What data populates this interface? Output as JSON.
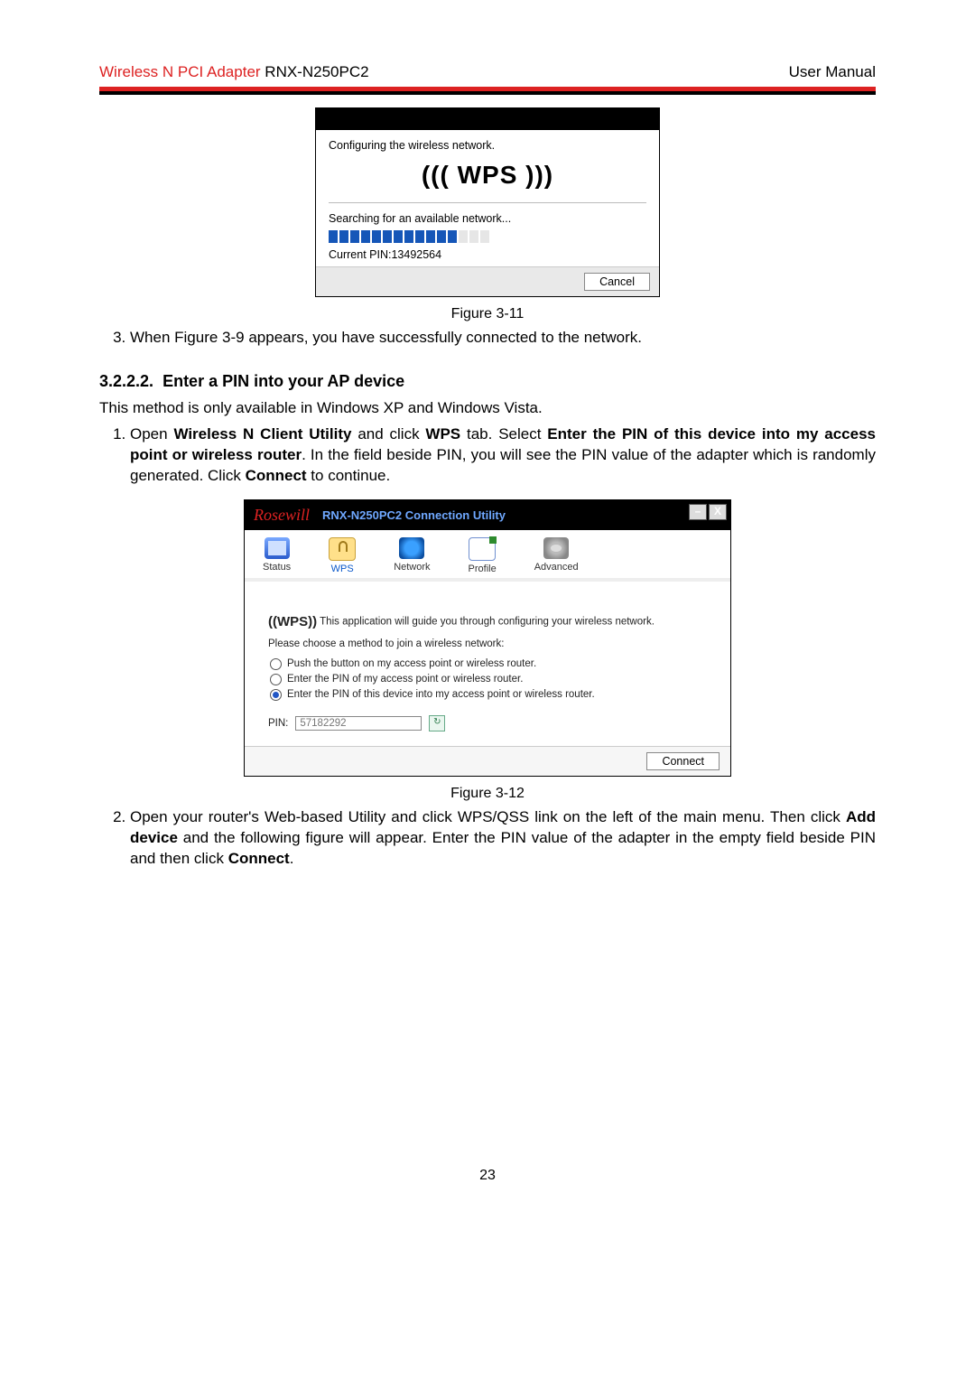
{
  "header": {
    "left_red": "Wireless N PCI Adapter",
    "left_black": " RNX-N250PC2",
    "right": "User Manual"
  },
  "dialog1": {
    "line1": "Configuring the wireless network.",
    "wps_label": "((( WPS )))",
    "line2": "Searching for an available network...",
    "pin_line": "Current PIN:13492564",
    "cancel": "Cancel"
  },
  "fig1_caption": "Figure 3-11",
  "step3": "When Figure 3-9 appears, you have successfully connected to the network.",
  "section_num": "3.2.2.2.",
  "section_title": "Enter a PIN into your AP device",
  "para_a": "This method is only available in Windows XP and Windows Vista.",
  "step1_pre": "Open ",
  "step1_b1": "Wireless N Client Utility",
  "step1_mid1": " and click ",
  "step1_b2": "WPS",
  "step1_mid2": " tab. Select ",
  "step1_b3": "Enter the PIN of this device into my access point or wireless router",
  "step1_mid3": ". In the field beside PIN, you will see the PIN value of the adapter which is randomly generated. Click ",
  "step1_b4": "Connect",
  "step1_end": " to continue.",
  "util": {
    "brand": "Rosewill",
    "title": "RNX-N250PC2 Connection Utility",
    "tabs": {
      "status": "Status",
      "wps": "WPS",
      "network": "Network",
      "profile": "Profile",
      "advanced": "Advanced"
    },
    "wps_label": "((WPS))",
    "intro": "This application will guide you through configuring your wireless network.",
    "choose": "Please choose a method to join a wireless network:",
    "opt1": "Push the button on my access point or wireless router.",
    "opt2": "Enter the PIN of my access point or wireless router.",
    "opt3": "Enter the PIN of this device into my access point or wireless router.",
    "pin_label": "PIN:",
    "pin_value": "57182292",
    "connect": "Connect"
  },
  "fig2_caption": "Figure 3-12",
  "step2_pre": "Open your router's Web-based Utility and click WPS/QSS link on the left of the main menu. Then click ",
  "step2_b1": "Add device",
  "step2_mid": " and the following figure will appear. Enter the PIN value of the adapter in the empty field beside PIN and then click ",
  "step2_b2": "Connect",
  "step2_end": ".",
  "page_number": "23"
}
